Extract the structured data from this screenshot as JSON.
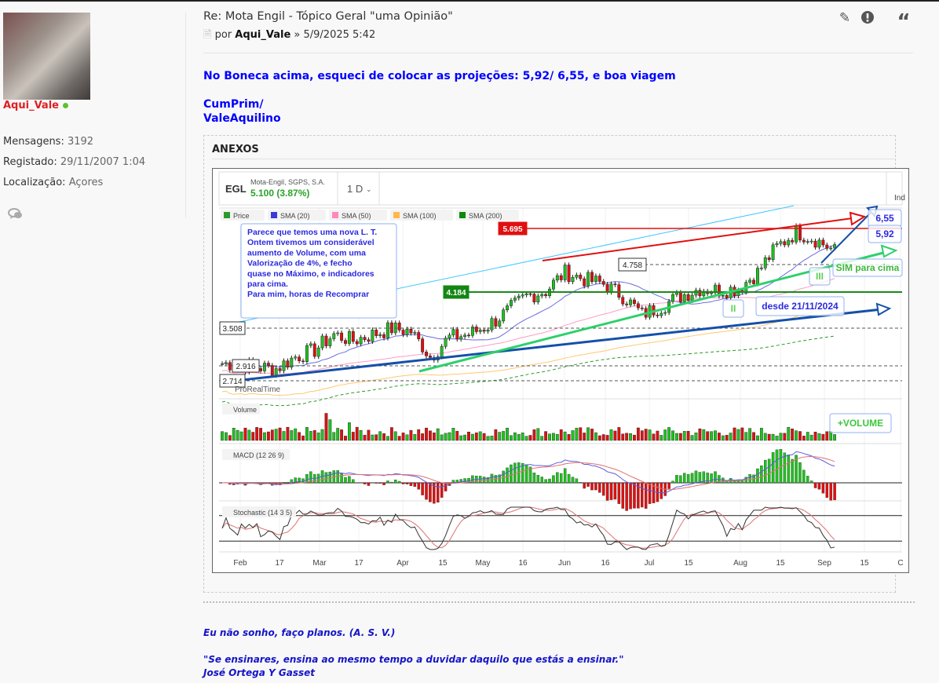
{
  "user": {
    "name": "Aqui_Vale",
    "stats": [
      {
        "label": "Mensagens:",
        "value": "3192"
      },
      {
        "label": "Registado:",
        "value": "29/11/2007 1:04"
      },
      {
        "label": "Localização:",
        "value": "Açores"
      }
    ]
  },
  "post": {
    "title": "Re: Mota Engil - Tópico Geral \"uma Opinião\"",
    "by_prefix": "por",
    "author": "Aqui_Vale",
    "date": "» 5/9/2025 5:42",
    "lines": [
      "No Boneca acima, esqueci de colocar as projeções: 5,92/ 6,55, e boa viagem",
      "CumPrim/",
      "ValeAquilino"
    ],
    "attachments_label": "ANEXOS"
  },
  "signature": [
    "Eu não sonho, faço planos. (A. S. V.)",
    "\"Se ensinares, ensina ao mesmo tempo a duvidar daquilo que estás a ensinar.\"",
    "José Ortega Y Gasset"
  ],
  "chart_data": {
    "type": "candlestick",
    "ticker": "EGL",
    "company": "Mota-Engil, SGPS, S.A.",
    "price": "5.100 (3.87%)",
    "interval": "1 D",
    "ind_label": "Ind",
    "legend": [
      "Price",
      "SMA (20)",
      "SMA (50)",
      "SMA (100)",
      "SMA (200)"
    ],
    "legend_colors": [
      "#2b9a2b",
      "#3a3ad8",
      "#ff88bb",
      "#ffb84d",
      "#0b8a0b"
    ],
    "levels": [
      "5.695",
      "4.758",
      "4.184",
      "3.508",
      "2.916",
      "2.714"
    ],
    "panes": [
      "Volume",
      "MACD (12 26 9)",
      "Stochastic (14 3 5)"
    ],
    "watermark": "ProRealTime",
    "x_ticks": [
      "Feb",
      "17",
      "Mar",
      "17",
      "Apr",
      "15",
      "May",
      "16",
      "Jun",
      "16",
      "Jul",
      "15",
      "Aug",
      "15",
      "Sep",
      "15",
      "C"
    ],
    "weekly_closes": [
      2.95,
      2.9,
      2.88,
      3.05,
      3.15,
      3.4,
      3.3,
      3.4,
      3.5,
      3.45,
      3.05,
      3.35,
      3.4,
      3.55,
      3.8,
      4.1,
      4.2,
      4.6,
      4.45,
      4.35,
      4.1,
      3.75,
      3.9,
      4.1,
      4.25,
      4.22,
      4.25,
      4.6,
      5.2,
      5.6,
      5.4,
      5.1
    ],
    "annotation": "Parece que temos uma nova L. T.\nOntem tivemos um considerável aumento de Volume, com uma Valorização de 4%, e fecho quase no Máximo, e indicadores para cima.\nPara mim, horas de Recomprar",
    "targets": [
      "6,55",
      "5,92"
    ],
    "labels": {
      "sim": "SIM para cima",
      "iii": "III",
      "ii": "II",
      "desde": "desde 21/11/2024",
      "vol": "+VOLUME"
    }
  }
}
